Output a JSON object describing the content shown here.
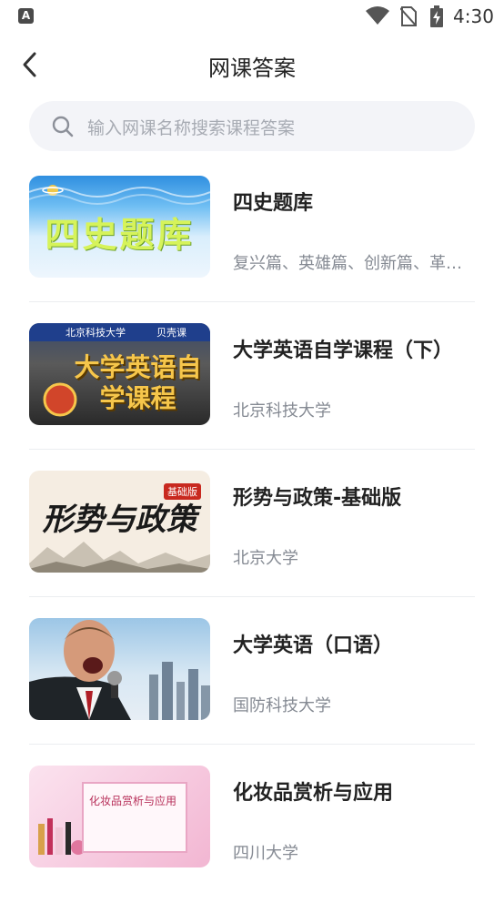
{
  "status_bar": {
    "app_badge": "A",
    "time": "4:30"
  },
  "header": {
    "title": "网课答案"
  },
  "search": {
    "placeholder": "输入网课名称搜索课程答案"
  },
  "courses": [
    {
      "title": "四史题库",
      "subtitle": "复兴篇、英雄篇、创新篇、革命篇",
      "thumb_text": "四史题库"
    },
    {
      "title": "大学英语自学课程（下）",
      "subtitle": "北京科技大学",
      "thumb_text": "大学英语自学课程",
      "thumb_brand_left": "北京科技大学",
      "thumb_brand_right": "贝壳课"
    },
    {
      "title": "形势与政策-基础版",
      "subtitle": "北京大学",
      "thumb_text": "形势与政策",
      "thumb_tag": "基础版"
    },
    {
      "title": "大学英语（口语）",
      "subtitle": "国防科技大学"
    },
    {
      "title": "化妆品赏析与应用",
      "subtitle": "四川大学",
      "thumb_text": "化妆品赏析与应用"
    }
  ]
}
